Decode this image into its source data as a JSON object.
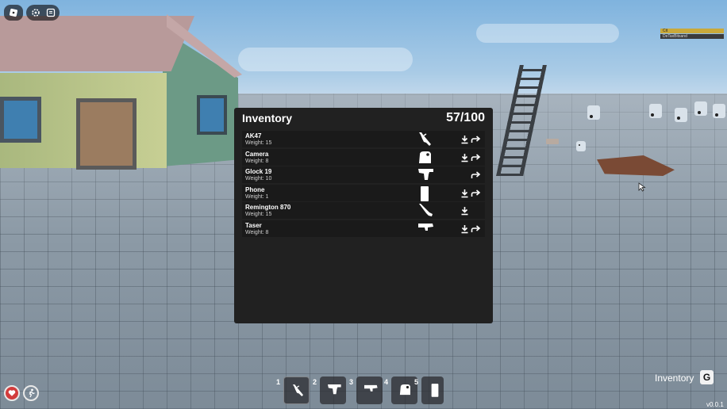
{
  "top_right_bars": [
    {
      "label": "Cit",
      "color": "#c9a93a"
    },
    {
      "label": "DeTaxBitsand",
      "color": "#3b3b3b"
    }
  ],
  "inventory": {
    "title": "Inventory",
    "count": "57/100",
    "items": [
      {
        "name": "AK47",
        "weight": "Weight: 15",
        "icon": "rifle-icon",
        "drop": true,
        "give": true
      },
      {
        "name": "Camera",
        "weight": "Weight: 8",
        "icon": "camera-icon",
        "drop": true,
        "give": true
      },
      {
        "name": "Glock 19",
        "weight": "Weight: 10",
        "icon": "pistol-icon",
        "drop": false,
        "give": true
      },
      {
        "name": "Phone",
        "weight": "Weight: 1",
        "icon": "phone-icon",
        "drop": true,
        "give": true
      },
      {
        "name": "Remington 870",
        "weight": "Weight: 15",
        "icon": "shotgun-icon",
        "drop": true,
        "give": false
      },
      {
        "name": "Taser",
        "weight": "Weight: 8",
        "icon": "taser-icon",
        "drop": true,
        "give": true
      }
    ]
  },
  "hotbar": {
    "slots": [
      {
        "number": "1",
        "icon": "rifle-icon",
        "active": true
      },
      {
        "number": "2",
        "icon": "pistol-icon",
        "active": false
      },
      {
        "number": "3",
        "icon": "taser-icon",
        "active": false
      },
      {
        "number": "4",
        "icon": "camera-icon",
        "active": false
      },
      {
        "number": "5",
        "icon": "phone-icon",
        "active": false
      }
    ]
  },
  "inventory_toggle": {
    "label": "Inventory",
    "key": "G"
  },
  "version": "v0.0.1",
  "colors": {
    "panel": "#212121",
    "row": "#1a1a1a",
    "health": "#d23c3c"
  }
}
